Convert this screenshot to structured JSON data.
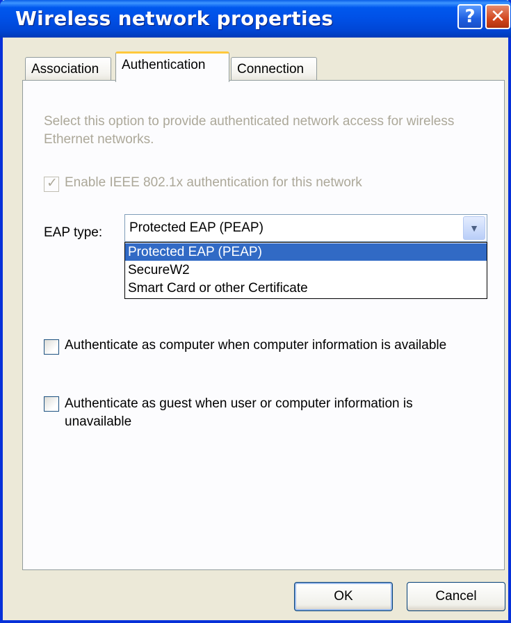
{
  "window": {
    "title": "Wireless network properties",
    "help_glyph": "?",
    "close_glyph": "✕"
  },
  "tabs": [
    {
      "label": "Association"
    },
    {
      "label": "Authentication"
    },
    {
      "label": "Connection"
    }
  ],
  "auth": {
    "description": "Select this option to provide authenticated network access for wireless Ethernet networks.",
    "enable_8021x": {
      "label": "Enable IEEE 802.1x authentication for this network",
      "checked": true,
      "disabled": true
    },
    "eap_label": "EAP type:",
    "eap_value": "Protected EAP (PEAP)",
    "eap_options": [
      "Protected EAP (PEAP)",
      "SecureW2",
      "Smart Card or other Certificate"
    ],
    "auth_computer": {
      "label": "Authenticate as computer when computer information is available",
      "checked": false
    },
    "auth_guest": {
      "label": "Authenticate as guest when user or computer information is unavailable",
      "checked": false
    }
  },
  "buttons": {
    "ok": "OK",
    "cancel": "Cancel"
  },
  "colors": {
    "titlebar": "#0058EE",
    "selection": "#316AC5",
    "tab_accent": "#FFC83C",
    "disabled_text": "#ACA899"
  }
}
